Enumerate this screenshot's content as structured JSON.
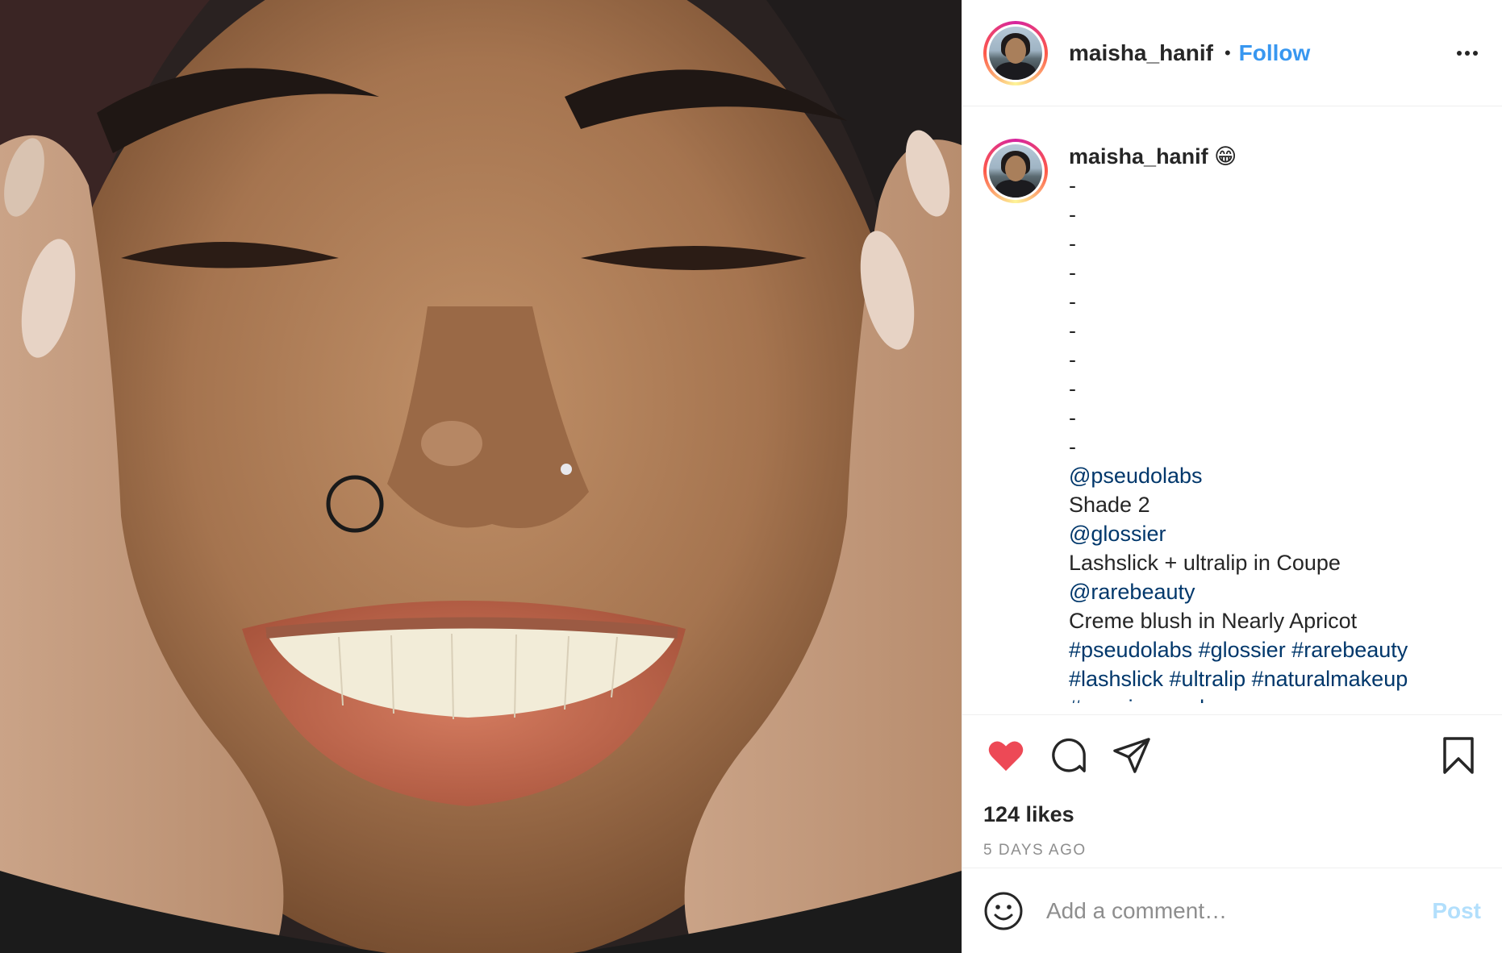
{
  "header": {
    "username": "maisha_hanif",
    "separator": "•",
    "follow_label": "Follow",
    "more_icon": "more-options-icon"
  },
  "caption": {
    "username": "maisha_hanif",
    "emoji": "😁",
    "lines": [
      {
        "text": "-",
        "type": "text"
      },
      {
        "text": "-",
        "type": "text"
      },
      {
        "text": "-",
        "type": "text"
      },
      {
        "text": "-",
        "type": "text"
      },
      {
        "text": "-",
        "type": "text"
      },
      {
        "text": "-",
        "type": "text"
      },
      {
        "text": "-",
        "type": "text"
      },
      {
        "text": "-",
        "type": "text"
      },
      {
        "text": "-",
        "type": "text"
      },
      {
        "text": "-",
        "type": "text"
      },
      {
        "text": "@pseudolabs",
        "type": "link"
      },
      {
        "text": "Shade 2",
        "type": "text"
      },
      {
        "text": "@glossier",
        "type": "link"
      },
      {
        "text": "Lashslick + ultralip in Coupe",
        "type": "text"
      },
      {
        "text": "@rarebeauty",
        "type": "link"
      },
      {
        "text": "Creme blush in Nearly Apricot",
        "type": "text"
      },
      {
        "text": "#pseudolabs #glossier #rarebeauty",
        "type": "link"
      },
      {
        "text": "#lashslick #ultralip #naturalmakeup",
        "type": "link"
      },
      {
        "text": "#seeninpseudo",
        "type": "link"
      }
    ]
  },
  "actions": {
    "like_icon": "heart-filled-icon",
    "comment_icon": "comment-icon",
    "share_icon": "share-icon",
    "save_icon": "bookmark-icon",
    "like_color": "#ed4956"
  },
  "likes_text": "124 likes",
  "time_text": "5 DAYS AGO",
  "comment": {
    "placeholder": "Add a comment…",
    "post_label": "Post",
    "emoji_icon": "emoji-icon"
  },
  "colors": {
    "link": "#00376b",
    "follow": "#3897f0",
    "post_disabled": "#b2dffc",
    "muted": "#8e8e8e"
  }
}
